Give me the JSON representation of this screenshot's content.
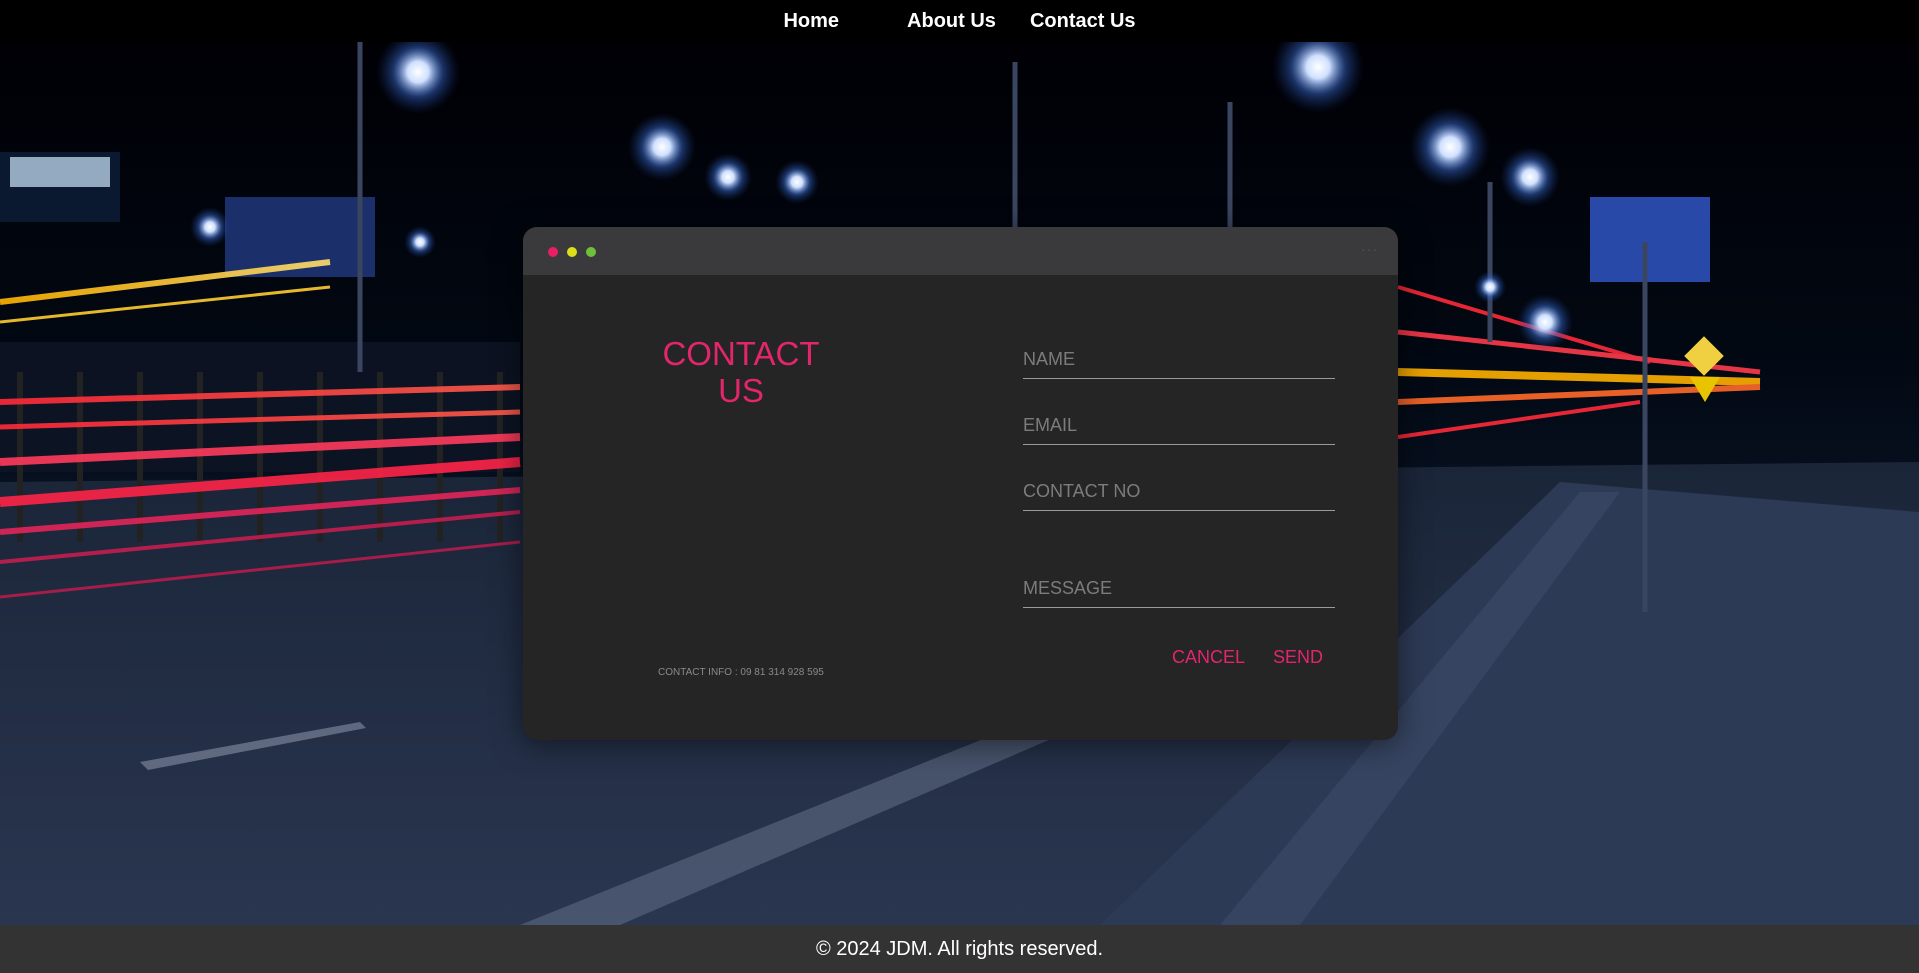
{
  "nav": {
    "home": "Home",
    "about": "About Us",
    "contact": "Contact Us"
  },
  "card": {
    "title": "CONTACT US",
    "contact_info": "CONTACT INFO : 09 81 314 928 595",
    "fields": {
      "name_placeholder": "NAME",
      "email_placeholder": "EMAIL",
      "phone_placeholder": "CONTACT NO",
      "message_placeholder": "MESSAGE"
    },
    "cancel_label": "CANCEL",
    "send_label": "SEND",
    "more_icon": "more-dots-icon"
  },
  "footer": {
    "copyright": "© 2024 JDM. All rights reserved."
  },
  "colors": {
    "accent": "#e3256b",
    "card_bg": "#252526",
    "titlebar_bg": "#3a393c",
    "footer_bg": "#333333",
    "dot_red": "#e91e63",
    "dot_yellow": "#dede1a",
    "dot_green": "#6fbf3a"
  }
}
